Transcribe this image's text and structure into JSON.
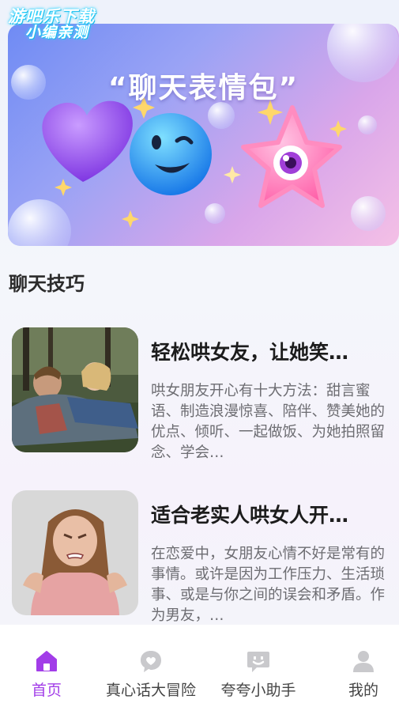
{
  "watermark": {
    "line1": "游吧乐下载",
    "line2": "小编亲测"
  },
  "banner": {
    "title": "“聊天表情包”"
  },
  "section": {
    "title": "聊天技巧"
  },
  "articles": [
    {
      "title": "轻松哄女友，让她笑…",
      "description": "哄女朋友开心有十大方法：甜言蜜语、制造浪漫惊喜、陪伴、赞美她的优点、倾听、一起做饭、为她拍照留念、学会…"
    },
    {
      "title": "适合老实人哄女人开…",
      "description": "在恋爱中，女朋友心情不好是常有的事情。或许是因为工作压力、生活琐事、或是与你之间的误会和矛盾。作为男友，…"
    }
  ],
  "tabbar": {
    "tabs": [
      {
        "label": "首页",
        "icon": "home-icon",
        "active": true
      },
      {
        "label": "真心话大冒险",
        "icon": "heart-chat-icon",
        "active": false
      },
      {
        "label": "夸夸小助手",
        "icon": "smile-chat-icon",
        "active": false
      },
      {
        "label": "我的",
        "icon": "user-icon",
        "active": false
      }
    ]
  },
  "colors": {
    "accent": "#a23de8",
    "inactive_icon": "#c9c9cc"
  }
}
